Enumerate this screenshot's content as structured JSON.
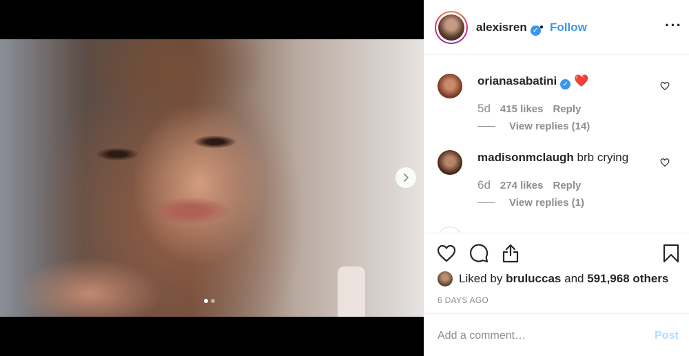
{
  "media": {
    "next_icon": "chevron-right-icon",
    "carousel_dots": [
      {
        "active": true
      },
      {
        "active": false
      }
    ]
  },
  "header": {
    "username": "alexisren",
    "verified": true,
    "separator": "•",
    "follow_label": "Follow",
    "more_label": "···"
  },
  "comments": [
    {
      "username": "orianasabatini",
      "verified": true,
      "text": "❤️",
      "age": "5d",
      "likes": "415 likes",
      "reply_label": "Reply",
      "view_replies": "View replies (14)"
    },
    {
      "username": "madisonmclaugh",
      "verified": false,
      "text": "brb crying",
      "age": "6d",
      "likes": "274 likes",
      "reply_label": "Reply",
      "view_replies": "View replies (1)"
    }
  ],
  "likes": {
    "prefix": "Liked by",
    "user": "bruluccas",
    "conjunction": "and",
    "count": "591,968 others"
  },
  "timestamp": "6 DAYS AGO",
  "comment_box": {
    "placeholder": "Add a comment…",
    "post_label": "Post"
  },
  "colors": {
    "accent": "#3897f0",
    "like_red": "#ed4956",
    "post_disabled": "#b3dbff",
    "muted": "#8e8e8e"
  }
}
